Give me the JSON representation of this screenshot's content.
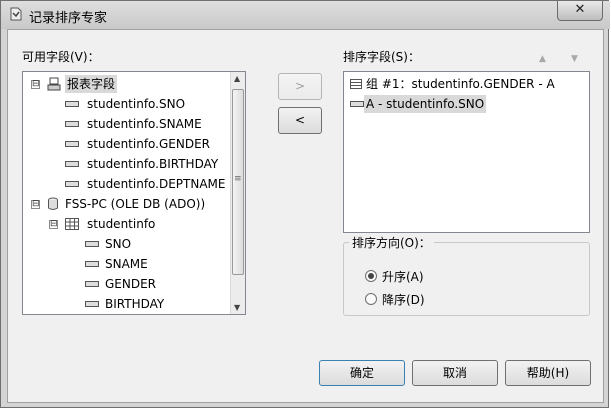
{
  "window": {
    "title": "记录排序专家",
    "close_glyph": "✕"
  },
  "available_fields": {
    "label": "可用字段(V)：",
    "items": [
      {
        "text": "报表字段",
        "expander": "⊟"
      },
      {
        "text": "studentinfo.SNO"
      },
      {
        "text": "studentinfo.SNAME"
      },
      {
        "text": "studentinfo.GENDER"
      },
      {
        "text": "studentinfo.BIRTHDAY"
      },
      {
        "text": "studentinfo.DEPTNAME"
      },
      {
        "text": "FSS-PC (OLE DB (ADO))",
        "expander": "⊟"
      },
      {
        "text": "studentinfo",
        "expander": "⊟"
      },
      {
        "text": "SNO"
      },
      {
        "text": "SNAME"
      },
      {
        "text": "GENDER"
      },
      {
        "text": "BIRTHDAY"
      }
    ]
  },
  "move_buttons": {
    "add": ">",
    "remove": "<"
  },
  "sort_fields": {
    "label": "排序字段(S)：",
    "up_arrow": "▲",
    "down_arrow": "▼",
    "items": [
      {
        "text": "组 #1：studentinfo.GENDER - A"
      },
      {
        "text": "A  -  studentinfo.SNO"
      }
    ]
  },
  "sort_direction": {
    "label": "排序方向(O)：",
    "ascending": "升序(A)",
    "descending": "降序(D)",
    "selected": "ascending"
  },
  "footer": {
    "ok": "确定",
    "cancel": "取消",
    "help": "帮助(H)"
  },
  "scroll_arrows": {
    "up": "▲",
    "down": "▼",
    "grip": "≡"
  }
}
